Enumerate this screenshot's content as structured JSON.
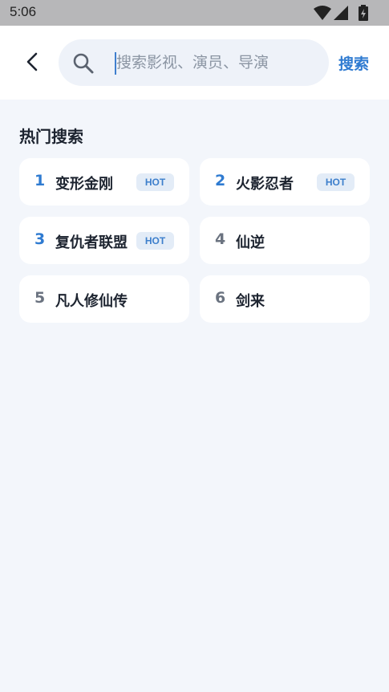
{
  "status_bar": {
    "time": "5:06",
    "icons": [
      "wifi-icon",
      "signal-icon",
      "battery-icon"
    ]
  },
  "header": {
    "back_icon": "chevron-left-icon",
    "search": {
      "placeholder": "搜索影视、演员、导演",
      "value": ""
    },
    "search_button": "搜索"
  },
  "hot_search": {
    "title": "热门搜索",
    "items": [
      {
        "rank": "1",
        "title": "变形金刚",
        "badge": "HOT"
      },
      {
        "rank": "2",
        "title": "火影忍者",
        "badge": "HOT"
      },
      {
        "rank": "3",
        "title": "复仇者联盟",
        "badge": "HOT"
      },
      {
        "rank": "4",
        "title": "仙逆",
        "badge": ""
      },
      {
        "rank": "5",
        "title": "凡人修仙传",
        "badge": ""
      },
      {
        "rank": "6",
        "title": "剑来",
        "badge": ""
      }
    ]
  },
  "colors": {
    "accent": "#2f7bd1",
    "background": "#f3f6fb",
    "card": "#ffffff"
  }
}
